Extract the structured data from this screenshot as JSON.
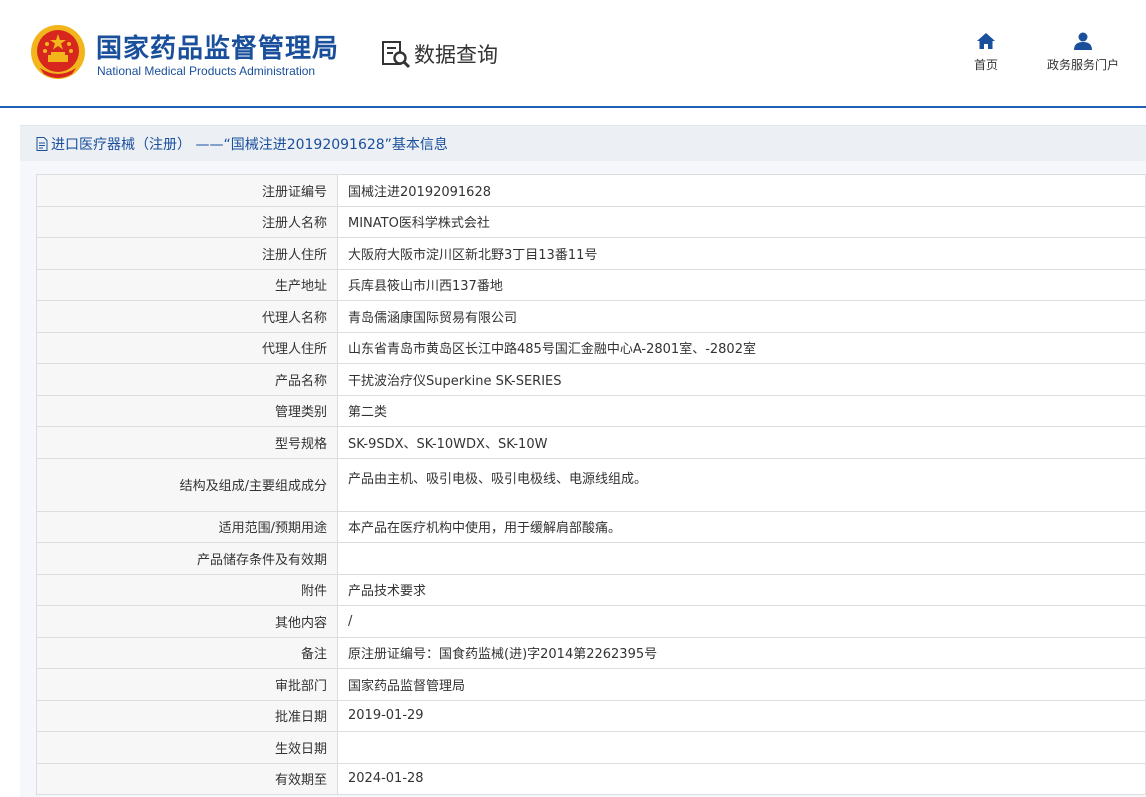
{
  "header": {
    "logo_cn": "国家药品监督管理局",
    "logo_en": "National Medical Products Administration",
    "query_label": "数据查询",
    "nav": [
      {
        "label": "首页",
        "icon": "home-icon"
      },
      {
        "label": "政务服务门户",
        "icon": "user-icon"
      }
    ]
  },
  "title": "进口医疗器械（注册） ——“国械注进20192091628”基本信息",
  "colors": {
    "brand": "#1a4f9c",
    "line": "#1f5fb5",
    "emblem_red": "#d7261e",
    "emblem_gold": "#f2b51c"
  },
  "rows": [
    {
      "label": "注册证编号",
      "value": "国械注进20192091628"
    },
    {
      "label": "注册人名称",
      "value": "MINATO医科学株式会社"
    },
    {
      "label": "注册人住所",
      "value": "大阪府大阪市淀川区新北野3丁目13番11号"
    },
    {
      "label": "生产地址",
      "value": "兵库县筱山市川西137番地"
    },
    {
      "label": "代理人名称",
      "value": "青岛儒涵康国际贸易有限公司"
    },
    {
      "label": "代理人住所",
      "value": "山东省青岛市黄岛区长江中路485号国汇金融中心A-2801室、-2802室"
    },
    {
      "label": "产品名称",
      "value": "干扰波治疗仪Superkine SK-SERIES"
    },
    {
      "label": "管理类别",
      "value": "第二类"
    },
    {
      "label": "型号规格",
      "value": "SK-9SDX、SK-10WDX、SK-10W"
    },
    {
      "label": "结构及组成/主要组成成分",
      "value": "产品由主机、吸引电极、吸引电极线、电源线组成。"
    },
    {
      "label": "适用范围/预期用途",
      "value": "本产品在医疗机构中使用，用于缓解肩部酸痛。"
    },
    {
      "label": "产品储存条件及有效期",
      "value": ""
    },
    {
      "label": "附件",
      "value": "产品技术要求"
    },
    {
      "label": "其他内容",
      "value": "/"
    },
    {
      "label": "备注",
      "value": "原注册证编号：国食药监械(进)字2014第2262395号"
    },
    {
      "label": "审批部门",
      "value": "国家药品监督管理局"
    },
    {
      "label": "批准日期",
      "value": "2019-01-29"
    },
    {
      "label": "生效日期",
      "value": ""
    },
    {
      "label": "有效期至",
      "value": "2024-01-28"
    }
  ]
}
